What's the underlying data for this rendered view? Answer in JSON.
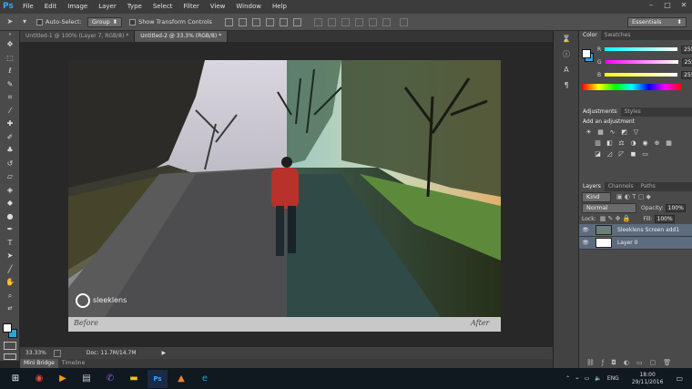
{
  "app": {
    "logo": "Ps"
  },
  "menu": [
    "File",
    "Edit",
    "Image",
    "Layer",
    "Type",
    "Select",
    "Filter",
    "View",
    "Window",
    "Help"
  ],
  "window_controls": [
    "–",
    "□",
    "✕"
  ],
  "options": {
    "auto_select_label": "Auto-Select:",
    "group_value": "Group",
    "show_transform_label": "Show Transform Controls",
    "workspace": "Essentials"
  },
  "doc_tabs": [
    {
      "label": "Untitled-1 @ 100% (Layer 7, RGB/8) *",
      "active": false
    },
    {
      "label": "Untitled-2 @ 33.3% (RGB/8) *",
      "active": true
    }
  ],
  "photo": {
    "brand": "sleeklens",
    "before_label": "Before",
    "after_label": "After"
  },
  "status": {
    "zoom": "33.33%",
    "doc": "Doc: 11.7M/14.7M"
  },
  "bottom_tabs": [
    "Mini Bridge",
    "Timeline"
  ],
  "color_panel": {
    "tabs": [
      "Color",
      "Swatches"
    ],
    "r_label": "R",
    "r_value": "255",
    "g_label": "G",
    "g_value": "255",
    "b_label": "B",
    "b_value": "255"
  },
  "adjustments_panel": {
    "tabs": [
      "Adjustments",
      "Styles"
    ],
    "heading": "Add an adjustment"
  },
  "layers_panel": {
    "tabs": [
      "Layers",
      "Channels",
      "Paths"
    ],
    "kind": "Kind",
    "blend_mode": "Normal",
    "opacity_label": "Opacity:",
    "opacity_value": "100%",
    "lock_label": "Lock:",
    "fill_label": "Fill:",
    "fill_value": "100%",
    "layers": [
      {
        "name": "Sleeklens Screen add1"
      },
      {
        "name": "Layer 0"
      }
    ]
  },
  "taskbar": {
    "language": "ENG",
    "time": "18:00",
    "date": "29/11/2016"
  },
  "colors": {
    "accent": "#31a8ff",
    "layer_selected": "#5d6b7e",
    "bg_swatch": "#27a7df"
  }
}
